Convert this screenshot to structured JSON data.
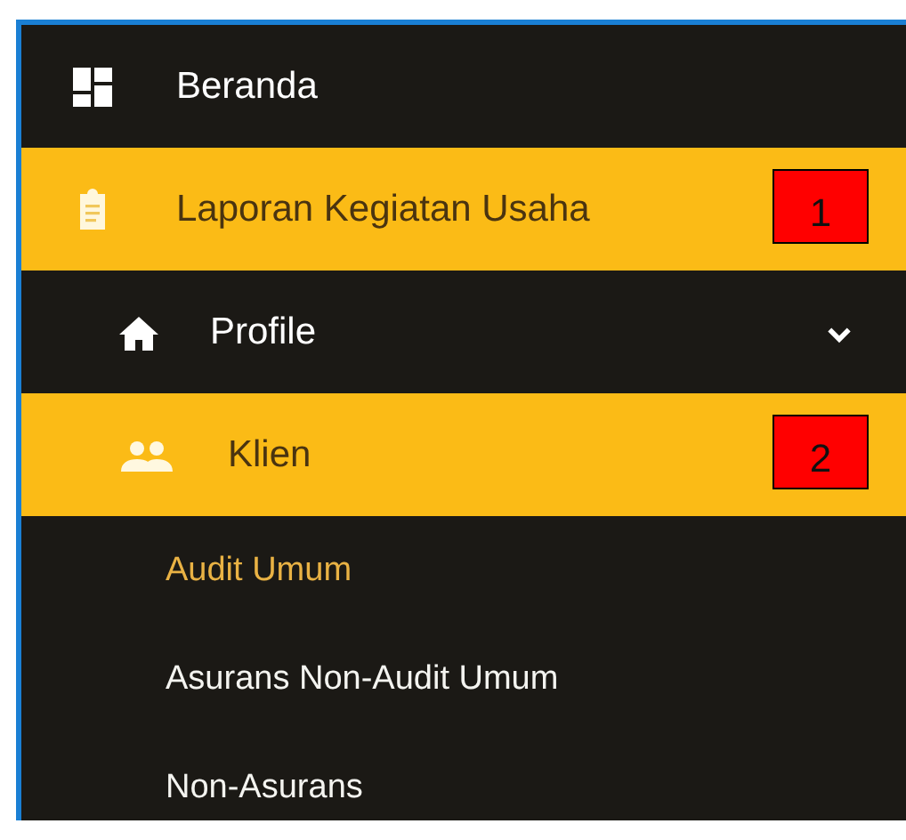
{
  "menu": [
    {
      "kind": "dashboard",
      "label": "Beranda",
      "selected": false,
      "dropdown": false
    },
    {
      "kind": "clipboard",
      "label": "Laporan Kegiatan Usaha",
      "selected": true,
      "dropdown": false,
      "callout": "1",
      "children": [
        {
          "kind": "home",
          "label": "Profile",
          "selected": false,
          "dropdown": true
        },
        {
          "kind": "people",
          "label": "Klien",
          "selected": true,
          "dropdown": false,
          "callout": "2",
          "children": [
            {
              "kind": "link",
              "label": "Audit Umum",
              "selected": true,
              "dropdown": false
            },
            {
              "kind": "link",
              "label": "Asurans Non-Audit Umum",
              "selected": false,
              "dropdown": false
            },
            {
              "kind": "link",
              "label": "Non-Asurans",
              "selected": false,
              "dropdown": false
            }
          ]
        }
      ]
    }
  ]
}
